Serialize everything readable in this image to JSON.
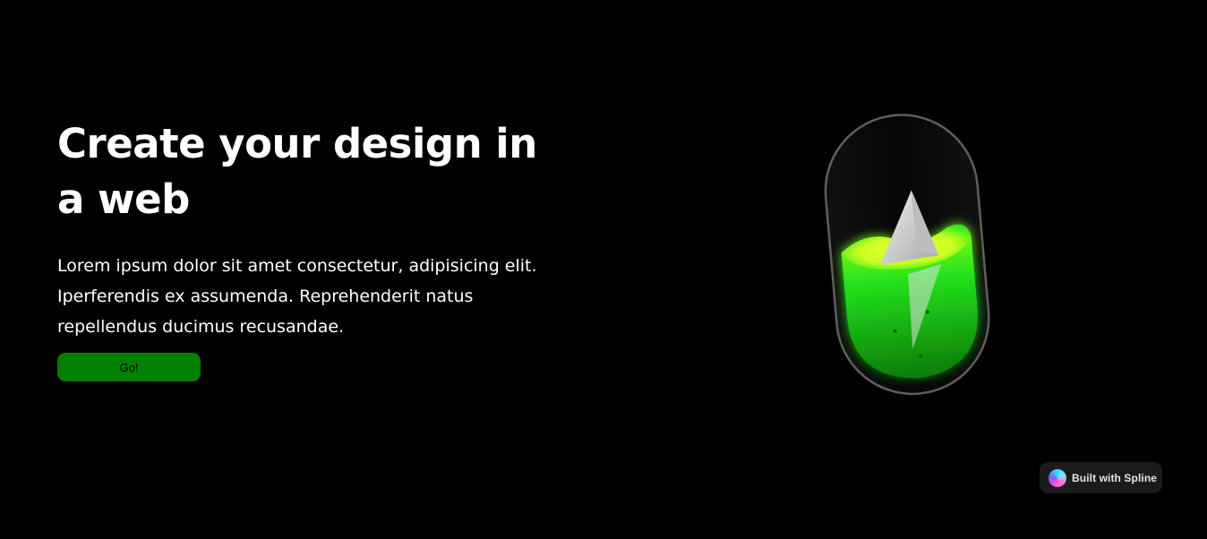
{
  "hero": {
    "title": "Create your design in a web",
    "description": "Lorem ipsum dolor sit amet consectetur, adipisicing elit. Iperferendis ex assumenda. Reprehenderit natus repellendus ducimus recusandae.",
    "button_label": "Go!"
  },
  "scene": {
    "icon": "battery-bolt-3d",
    "colors": {
      "liquid": "#22e01a",
      "liquid_top": "#d8ff2a",
      "bolt": "#d9d9d9",
      "capsule_outline": "#6b6b6b"
    }
  },
  "badge": {
    "label": "Built with Spline",
    "icon": "spline-logo-icon"
  },
  "colors": {
    "background": "#000000",
    "button": "#008000",
    "text": "#ffffff",
    "badge_bg": "#1b1b1d"
  }
}
